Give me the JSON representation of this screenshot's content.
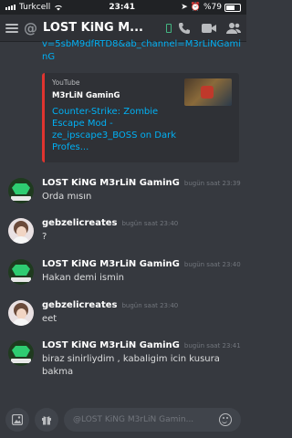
{
  "status_bar": {
    "carrier": "Turkcell",
    "time": "23:41",
    "battery": "%79"
  },
  "header": {
    "channel_name": "LOST KiNG  M..."
  },
  "previous_message": {
    "link_tail": "v=5sbM9dfRTD8&ab_channel=M3rLiNGaminG"
  },
  "embed": {
    "provider": "YouTube",
    "author": "M3rLiN GaminG",
    "title": "Counter-Strike: Zombie Escape Mod - ze_ipscape3_BOSS on Dark Profes...",
    "accent_color": "#e0342f"
  },
  "messages": [
    {
      "username": "LOST KiNG  M3rLiN GaminG",
      "timestamp": "bugün saat 23:39",
      "text": "Orda mısın",
      "avatar": "lost-king-avatar"
    },
    {
      "username": "gebzelicreates",
      "timestamp": "bugün saat 23:40",
      "text": "?",
      "avatar": "gebzelicreates-avatar"
    },
    {
      "username": "LOST KiNG  M3rLiN GaminG",
      "timestamp": "bugün saat 23:40",
      "text": "Hakan demi ismin",
      "avatar": "lost-king-avatar"
    },
    {
      "username": "gebzelicreates",
      "timestamp": "bugün saat 23:40",
      "text": "eet",
      "avatar": "gebzelicreates-avatar"
    },
    {
      "username": "LOST KiNG  M3rLiN GaminG",
      "timestamp": "bugün saat 23:41",
      "text": "biraz sinirliydim , kabaligim icin kusura bakma",
      "avatar": "lost-king-avatar"
    }
  ],
  "input": {
    "placeholder": "@LOST KiNG  M3rLiN Gamin..."
  },
  "icons": {
    "header": [
      "menu-icon",
      "phone-icon",
      "video-icon",
      "members-icon"
    ],
    "input": [
      "image-icon",
      "gift-icon",
      "emoji-icon"
    ]
  },
  "colors": {
    "background": "#36393f",
    "header": "#2f3136",
    "link": "#00b0f4"
  }
}
